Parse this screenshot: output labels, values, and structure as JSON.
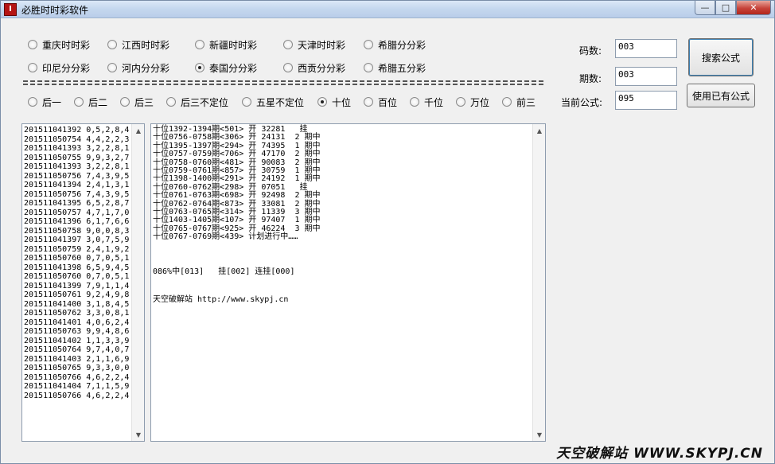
{
  "window": {
    "title": "必胜时时彩软件",
    "app_icon_glyph": "I",
    "min_glyph": "—",
    "max_glyph": "□",
    "close_glyph": "✕"
  },
  "lottery_types": [
    {
      "label": "重庆时时彩",
      "checked": false
    },
    {
      "label": "江西时时彩",
      "checked": false
    },
    {
      "label": "新疆时时彩",
      "checked": false
    },
    {
      "label": "天津时时彩",
      "checked": false
    },
    {
      "label": "希腊分分彩",
      "checked": false
    },
    {
      "label": "印尼分分彩",
      "checked": false
    },
    {
      "label": "河内分分彩",
      "checked": false
    },
    {
      "label": "泰国分分彩",
      "checked": true
    },
    {
      "label": "西贡分分彩",
      "checked": false
    },
    {
      "label": "希腊五分彩",
      "checked": false
    }
  ],
  "positions": [
    {
      "label": "后一",
      "checked": false
    },
    {
      "label": "后二",
      "checked": false
    },
    {
      "label": "后三",
      "checked": false
    },
    {
      "label": "后三不定位",
      "checked": false
    },
    {
      "label": "五星不定位",
      "checked": false
    },
    {
      "label": "十位",
      "checked": true
    },
    {
      "label": "百位",
      "checked": false
    },
    {
      "label": "千位",
      "checked": false
    },
    {
      "label": "万位",
      "checked": false
    },
    {
      "label": "前三",
      "checked": false
    }
  ],
  "params": {
    "code_count_label": "码数:",
    "code_count_value": "003",
    "period_count_label": "期数:",
    "period_count_value": "003",
    "current_formula_label": "当前公式:",
    "current_formula_value": "095"
  },
  "buttons": {
    "search": "搜索公式",
    "use_existing": "使用已有公式"
  },
  "history": [
    "201511041392 0,5,2,8,4",
    "201511050754 4,4,2,2,3",
    "201511041393 3,2,2,8,1",
    "201511050755 9,9,3,2,7",
    "201511041393 3,2,2,8,1",
    "201511050756 7,4,3,9,5",
    "201511041394 2,4,1,3,1",
    "201511050756 7,4,3,9,5",
    "201511041395 6,5,2,8,7",
    "201511050757 4,7,1,7,0",
    "201511041396 6,1,7,6,6",
    "201511050758 9,0,0,8,3",
    "201511041397 3,0,7,5,9",
    "201511050759 2,4,1,9,2",
    "201511050760 0,7,0,5,1",
    "201511041398 6,5,9,4,5",
    "201511050760 0,7,0,5,1",
    "201511041399 7,9,1,1,4",
    "201511050761 9,2,4,9,8",
    "201511041400 3,1,8,4,5",
    "201511050762 3,3,0,8,1",
    "201511041401 4,0,6,2,4",
    "201511050763 9,9,4,8,6",
    "201511041402 1,1,3,3,9",
    "201511050764 9,7,4,0,7",
    "201511041403 2,1,1,6,9",
    "201511050765 9,3,3,0,0",
    "201511050766 4,6,2,2,4",
    "201511041404 7,1,1,5,9",
    "201511050766 4,6,2,2,4"
  ],
  "results": [
    "十位1392-1394期<501> 开 32281   挂",
    "十位0756-0758期<306> 开 24131  2 期中",
    "十位1395-1397期<294> 开 74395  1 期中",
    "十位0757-0759期<706> 开 47170  2 期中",
    "十位0758-0760期<481> 开 90083  2 期中",
    "十位0759-0761期<857> 开 30759  1 期中",
    "十位1398-1400期<291> 开 24192  1 期中",
    "十位0760-0762期<298> 开 07051   挂",
    "十位0761-0763期<698> 开 92498  2 期中",
    "十位0762-0764期<873> 开 33081  2 期中",
    "十位0763-0765期<314> 开 11339  3 期中",
    "十位1403-1405期<107> 开 97407  1 期中",
    "十位0765-0767期<925> 开 46224  3 期中",
    "十位0767-0769期<439> 计划进行中……"
  ],
  "stats": "086%中[013]   挂[002] 连挂[000]",
  "site_line": "天空破解站 http://www.skypj.cn",
  "watermark": "天空破解站 WWW.SKYPJ.CN",
  "scroll": {
    "up_glyph": "▲",
    "down_glyph": "▼"
  }
}
